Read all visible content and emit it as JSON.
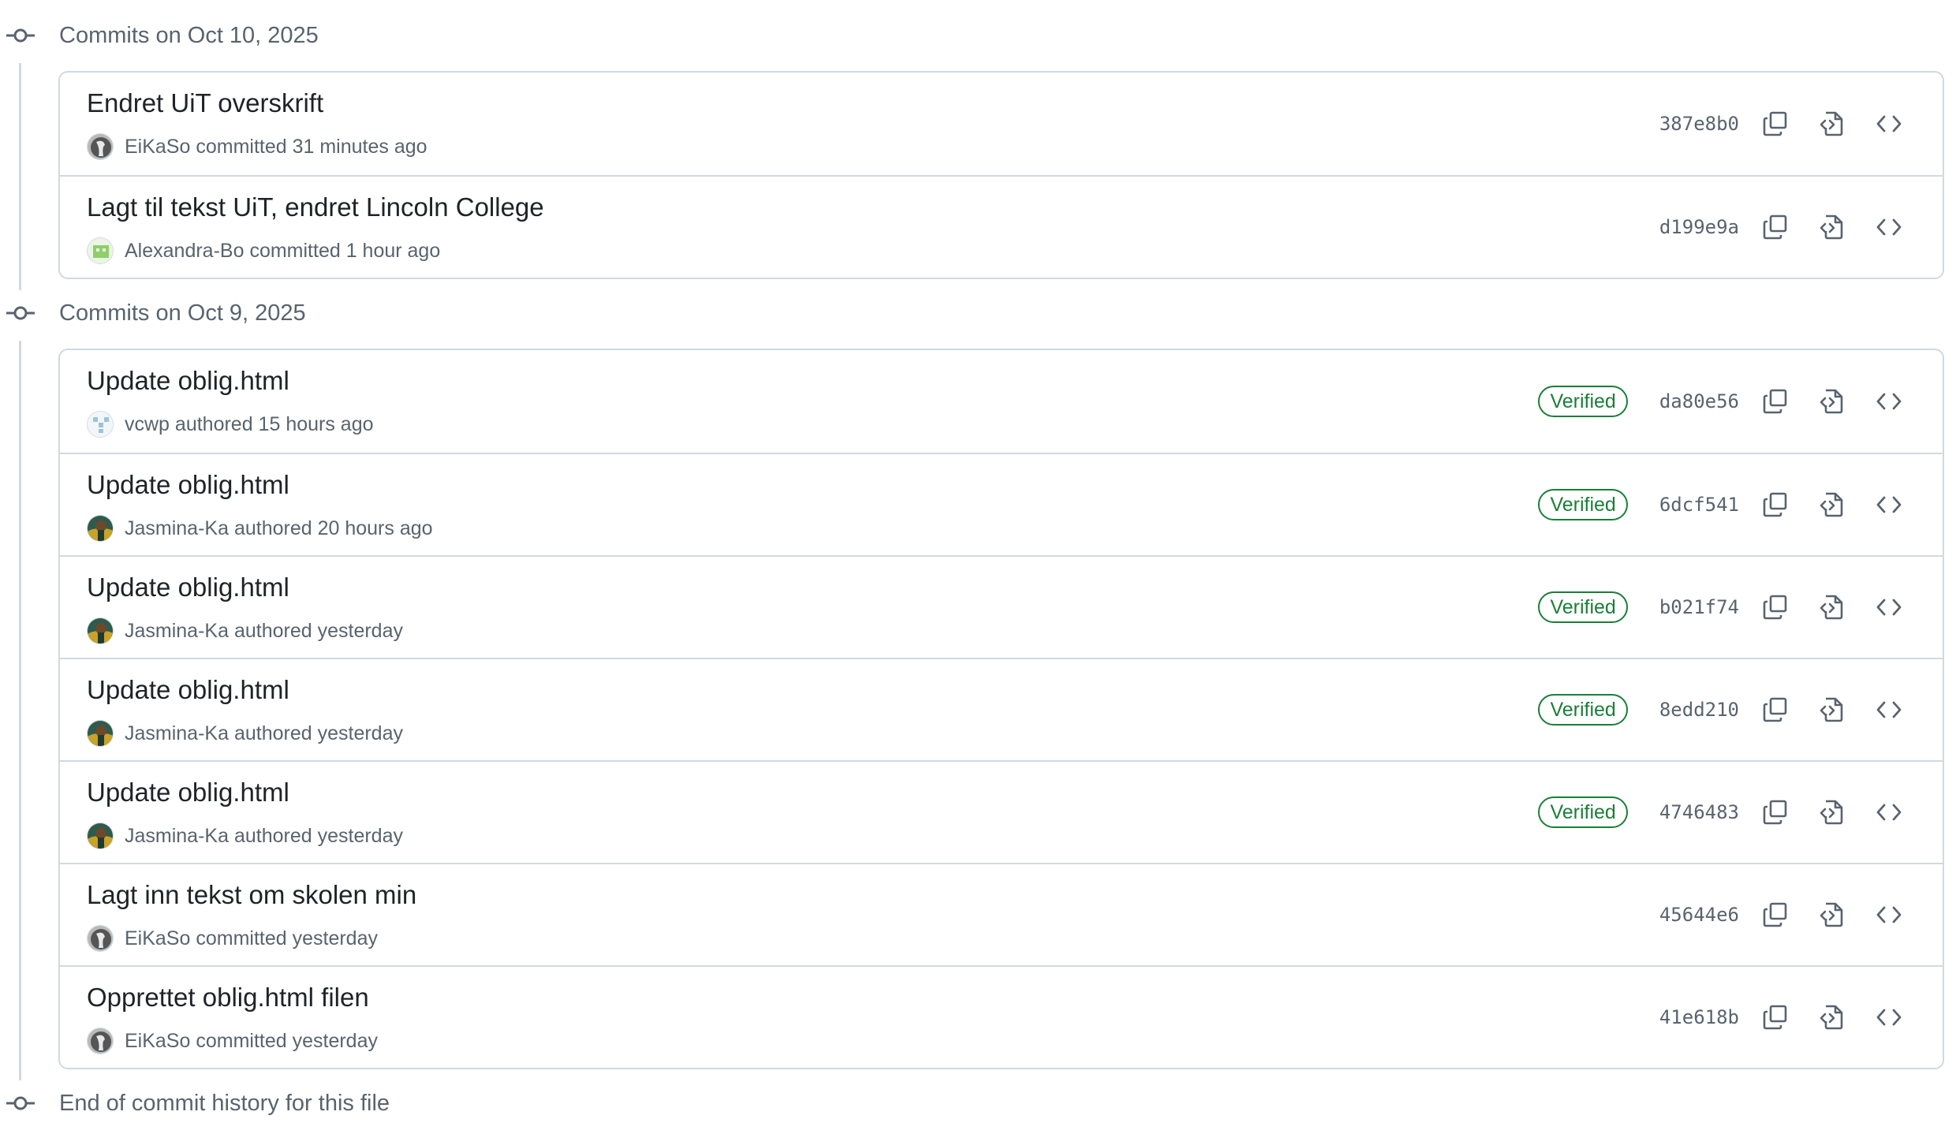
{
  "groups": [
    {
      "title": "Commits on Oct 10, 2025",
      "commits": [
        {
          "title": "Endret UiT overskrift",
          "author": "EiKaSo",
          "action": "committed",
          "time": "31 minutes ago",
          "sha": "387e8b0",
          "verified": false,
          "avatar": "eikaso"
        },
        {
          "title": "Lagt til tekst UiT, endret Lincoln College",
          "author": "Alexandra-Bo",
          "action": "committed",
          "time": "1 hour ago",
          "sha": "d199e9a",
          "verified": false,
          "avatar": "alexandra"
        }
      ]
    },
    {
      "title": "Commits on Oct 9, 2025",
      "commits": [
        {
          "title": "Update oblig.html",
          "author": "vcwp",
          "action": "authored",
          "time": "15 hours ago",
          "sha": "da80e56",
          "verified": true,
          "avatar": "vcwp"
        },
        {
          "title": "Update oblig.html",
          "author": "Jasmina-Ka",
          "action": "authored",
          "time": "20 hours ago",
          "sha": "6dcf541",
          "verified": true,
          "avatar": "jasmina"
        },
        {
          "title": "Update oblig.html",
          "author": "Jasmina-Ka",
          "action": "authored",
          "time": "yesterday",
          "sha": "b021f74",
          "verified": true,
          "avatar": "jasmina"
        },
        {
          "title": "Update oblig.html",
          "author": "Jasmina-Ka",
          "action": "authored",
          "time": "yesterday",
          "sha": "8edd210",
          "verified": true,
          "avatar": "jasmina"
        },
        {
          "title": "Update oblig.html",
          "author": "Jasmina-Ka",
          "action": "authored",
          "time": "yesterday",
          "sha": "4746483",
          "verified": true,
          "avatar": "jasmina"
        },
        {
          "title": "Lagt inn tekst om skolen min",
          "author": "EiKaSo",
          "action": "committed",
          "time": "yesterday",
          "sha": "45644e6",
          "verified": false,
          "avatar": "eikaso"
        },
        {
          "title": "Opprettet oblig.html filen",
          "author": "EiKaSo",
          "action": "committed",
          "time": "yesterday",
          "sha": "41e618b",
          "verified": false,
          "avatar": "eikaso"
        }
      ]
    }
  ],
  "verified_label": "Verified",
  "end_text": "End of commit history for this file",
  "icons": {
    "group_marker": "git-commit-icon",
    "copy": "copy-icon",
    "view_file": "file-code-icon",
    "browse": "code-icon"
  },
  "colors": {
    "verified": "#1a7f37",
    "border": "#d1d9e0",
    "muted_text": "#59636e",
    "text": "#1f2328"
  }
}
